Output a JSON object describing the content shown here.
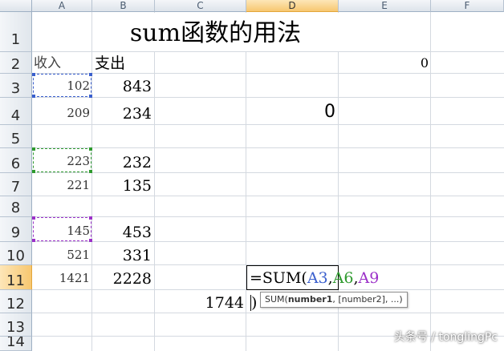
{
  "columns": [
    "A",
    "B",
    "C",
    "D",
    "E",
    "F"
  ],
  "selected_column": "D",
  "rows": [
    "1",
    "2",
    "3",
    "4",
    "5",
    "6",
    "7",
    "8",
    "9",
    "10",
    "11",
    "12",
    "13",
    "14"
  ],
  "selected_row": "11",
  "title": "sum函数的用法",
  "headers": {
    "income": "收入",
    "expense": "支出"
  },
  "e2_value": "0",
  "d4_value": "0",
  "income_values": {
    "a3": "102",
    "a4": "209",
    "a6": "223",
    "a7": "221",
    "a9": "145",
    "a10": "521",
    "a11": "1421"
  },
  "expense_values": {
    "b3": "843",
    "b4": "234",
    "b6": "232",
    "b7": "135",
    "b9": "453",
    "b10": "331",
    "b11": "2228"
  },
  "c12_value": "1744",
  "formula": {
    "prefix": "=SUM(",
    "ref1": "A3",
    "sep1": ",",
    "ref2": "A6",
    "sep2": ",",
    "ref3": "A9",
    "suffix": ")"
  },
  "ref_colors": {
    "ref1": "#3a5fcd",
    "ref2": "#2e9a2e",
    "ref3": "#9b30c8"
  },
  "tooltip": {
    "fn": "SUM(",
    "arg1": "number1",
    "rest": ", [number2], ...)"
  },
  "watermark": "头条号 / tonglingPc"
}
